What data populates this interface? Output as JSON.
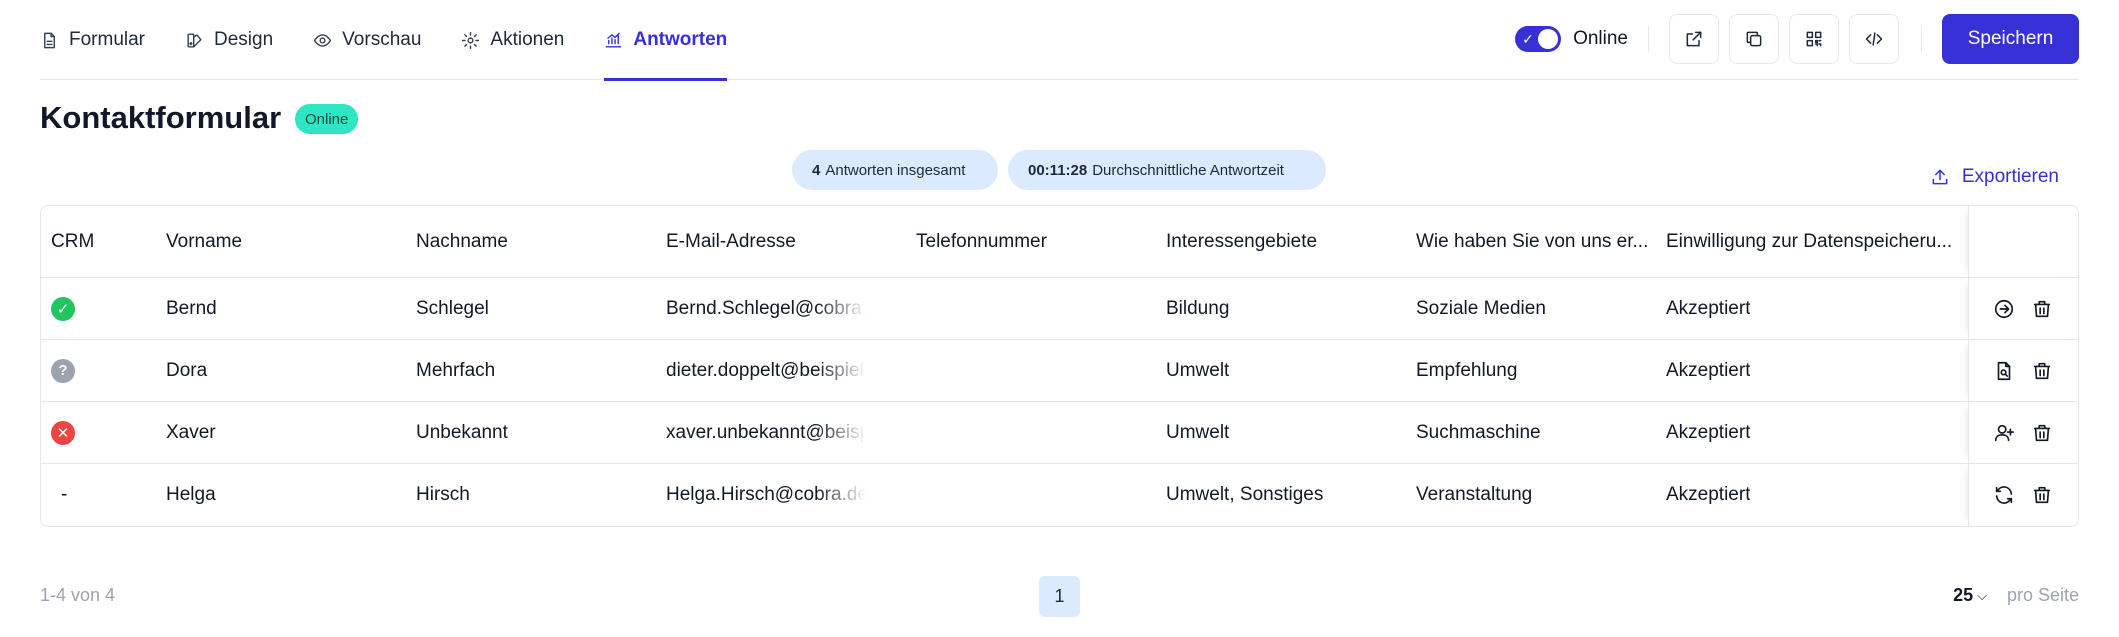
{
  "nav": {
    "tabs": [
      {
        "label": "Formular",
        "icon": "document-icon"
      },
      {
        "label": "Design",
        "icon": "palette-icon"
      },
      {
        "label": "Vorschau",
        "icon": "eye-icon"
      },
      {
        "label": "Aktionen",
        "icon": "gear-icon"
      },
      {
        "label": "Antworten",
        "icon": "chart-icon",
        "active": true
      }
    ],
    "online_label": "Online",
    "save_label": "Speichern"
  },
  "header": {
    "title": "Kontaktformular",
    "badge": "Online"
  },
  "stats": {
    "responses_value": "4",
    "responses_label": "Antworten insgesamt",
    "time_value": "00:11:28",
    "time_label": "Durchschnittliche Antwortzeit"
  },
  "export_label": "Exportieren",
  "table": {
    "columns": [
      "CRM",
      "Vorname",
      "Nachname",
      "E-Mail-Adresse",
      "Telefonnummer",
      "Interessengebiete",
      "Wie haben Sie von uns er...",
      "Einwilligung zur Datenspeicheru..."
    ],
    "rows": [
      {
        "crm": "success",
        "vorname": "Bernd",
        "nachname": "Schlegel",
        "email": "Bernd.Schlegel@cobra.de",
        "telefon": "",
        "interessen": "Bildung",
        "quelle": "Soziale Medien",
        "einwilligung": "Akzeptiert",
        "action": "arrow-right-circle-icon"
      },
      {
        "crm": "unknown",
        "vorname": "Dora",
        "nachname": "Mehrfach",
        "email": "dieter.doppelt@beispiel.de",
        "telefon": "",
        "interessen": "Umwelt",
        "quelle": "Empfehlung",
        "einwilligung": "Akzeptiert",
        "action": "file-search-icon"
      },
      {
        "crm": "error",
        "vorname": "Xaver",
        "nachname": "Unbekannt",
        "email": "xaver.unbekannt@beispiel.de",
        "telefon": "",
        "interessen": "Umwelt",
        "quelle": "Suchmaschine",
        "einwilligung": "Akzeptiert",
        "action": "user-plus-icon"
      },
      {
        "crm": "none",
        "crm_text": "-",
        "vorname": "Helga",
        "nachname": "Hirsch",
        "email": "Helga.Hirsch@cobra.de",
        "telefon": "",
        "interessen": "Umwelt, Sonstiges",
        "quelle": "Veranstaltung",
        "einwilligung": "Akzeptiert",
        "action": "refresh-icon"
      }
    ]
  },
  "footer": {
    "range": "1-4 von 4",
    "page": "1",
    "per_page_value": "25",
    "per_page_label": "pro Seite"
  },
  "colors": {
    "accent": "#3730d6",
    "online_badge": "#2ee6c4",
    "success": "#22c55e",
    "unknown": "#9ca3af",
    "error": "#ef4444",
    "stat_bg": "#dbeafe"
  }
}
